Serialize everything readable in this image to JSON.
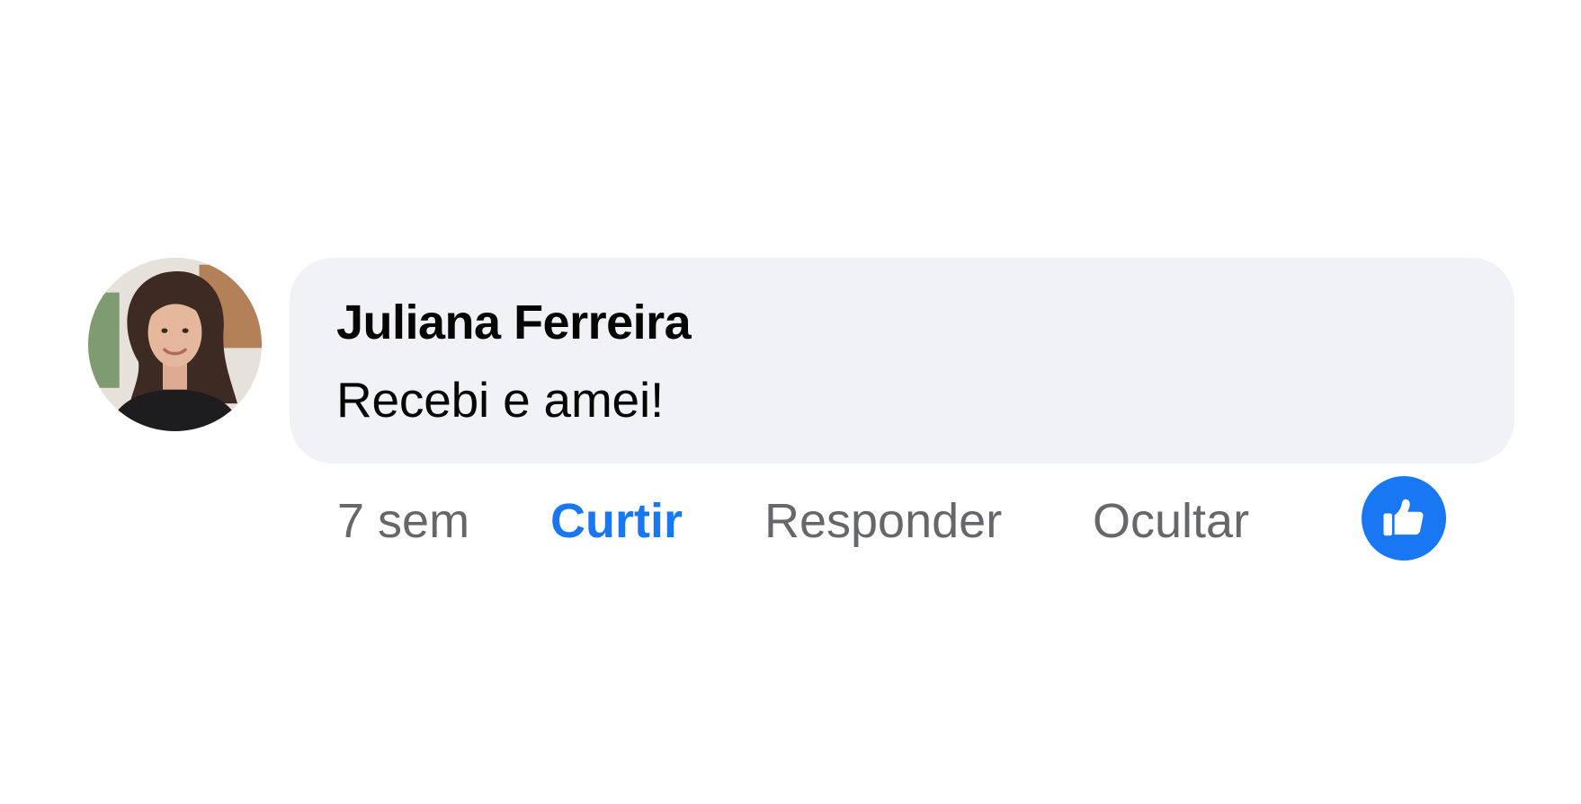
{
  "comment": {
    "author": "Juliana Ferreira",
    "text": "Recebi e amei!",
    "avatar_icon": "user-photo-avatar",
    "bubble_color": "#f0f2f5"
  },
  "actions": {
    "timestamp": "7 sem",
    "like_label": "Curtir",
    "reply_label": "Responder",
    "hide_label": "Ocultar",
    "like_color": "#1877f2"
  },
  "reaction": {
    "icon": "thumbs-up-icon",
    "color": "#1877f2"
  }
}
